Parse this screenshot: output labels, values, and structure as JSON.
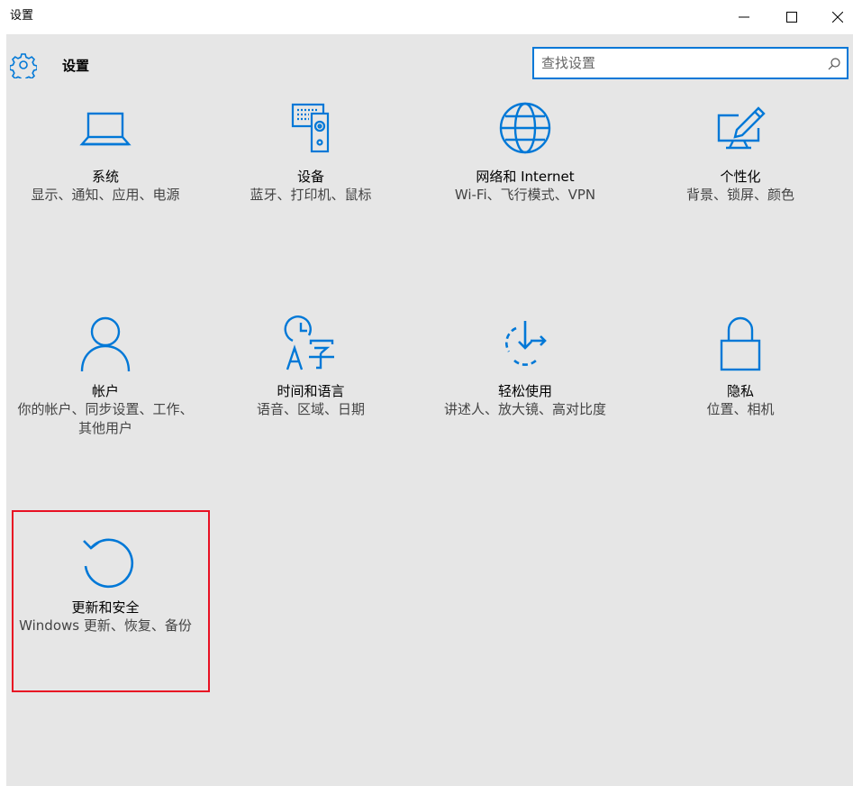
{
  "window": {
    "title": "设置",
    "controls": {
      "minimize": "—",
      "maximize": "☐",
      "close": "✕"
    }
  },
  "header": {
    "title": "设置",
    "search_placeholder": "查找设置"
  },
  "accent_color": "#0078d7",
  "selection_color": "#e81123",
  "tiles": [
    {
      "icon": "laptop-icon",
      "title": "系统",
      "desc": "显示、通知、应用、电源"
    },
    {
      "icon": "devices-icon",
      "title": "设备",
      "desc": "蓝牙、打印机、鼠标"
    },
    {
      "icon": "globe-icon",
      "title": "网络和 Internet",
      "desc": "Wi-Fi、飞行模式、VPN"
    },
    {
      "icon": "personalization-icon",
      "title": "个性化",
      "desc": "背景、锁屏、颜色"
    },
    {
      "icon": "person-icon",
      "title": "帐户",
      "desc": "你的帐户、同步设置、工作、其他用户"
    },
    {
      "icon": "time-language-icon",
      "title": "时间和语言",
      "desc": "语音、区域、日期"
    },
    {
      "icon": "ease-of-access-icon",
      "title": "轻松使用",
      "desc": "讲述人、放大镜、高对比度"
    },
    {
      "icon": "lock-icon",
      "title": "隐私",
      "desc": "位置、相机"
    },
    {
      "icon": "update-icon",
      "title": "更新和安全",
      "desc": "Windows 更新、恢复、备份",
      "selected": true
    }
  ]
}
